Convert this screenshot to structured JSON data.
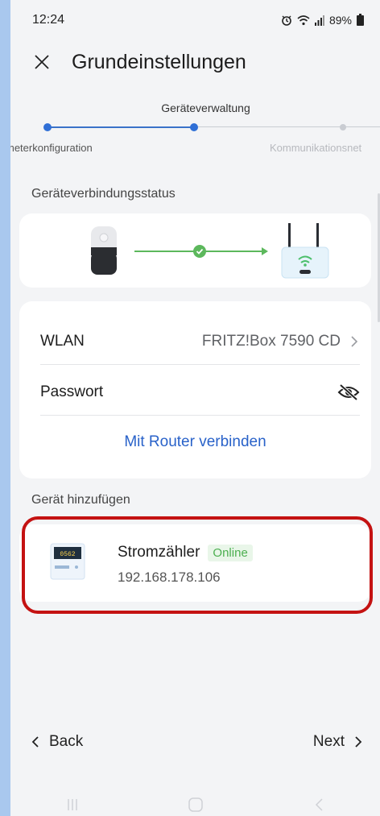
{
  "status_bar": {
    "time": "12:24",
    "battery": "89%",
    "icons": [
      "alarm-icon",
      "wifi-icon",
      "signal-icon",
      "battery-icon"
    ]
  },
  "header": {
    "title": "Grundeinstellungen"
  },
  "stepper": {
    "current_label": "Geräteverwaltung",
    "left_label": "meterkonfiguration",
    "right_label": "Kommunikationsnet"
  },
  "connection": {
    "section_label": "Geräteverbindungsstatus"
  },
  "wlan_settings": {
    "wlan_label": "WLAN",
    "wlan_value": "FRITZ!Box 7590 CD",
    "password_label": "Passwort",
    "connect_label": "Mit Router verbinden"
  },
  "add_device": {
    "section_label": "Gerät hinzufügen",
    "device_name": "Stromzähler",
    "device_status": "Online",
    "device_ip": "192.168.178.106",
    "meter_display": "0562"
  },
  "footer": {
    "back_label": "Back",
    "next_label": "Next"
  },
  "colors": {
    "accent": "#2f6fd6",
    "online": "#4caf50",
    "highlight": "#c41212",
    "link": "#2962c9"
  }
}
